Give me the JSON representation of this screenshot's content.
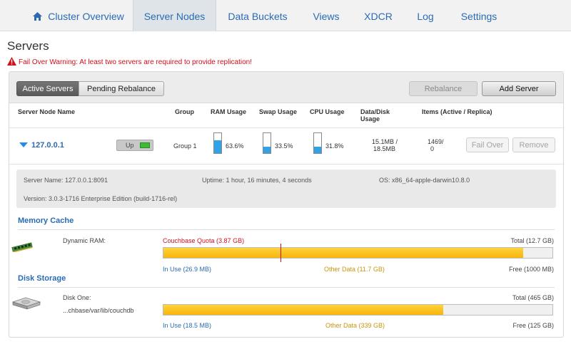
{
  "nav": {
    "tabs": [
      {
        "label": "Cluster Overview",
        "icon": "home-icon"
      },
      {
        "label": "Server Nodes",
        "active": true
      },
      {
        "label": "Data Buckets"
      },
      {
        "label": "Views"
      },
      {
        "label": "XDCR"
      },
      {
        "label": "Log"
      },
      {
        "label": "Settings"
      }
    ]
  },
  "page": {
    "title": "Servers",
    "warning": "Fail Over Warning: At least two servers are required to provide replication!"
  },
  "toolbar": {
    "active_tab": "Active Servers",
    "pending_tab": "Pending Rebalance",
    "rebalance": "Rebalance",
    "add_server": "Add Server"
  },
  "columns": {
    "name": "Server Node Name",
    "group": "Group",
    "ram": "RAM Usage",
    "swap": "Swap Usage",
    "cpu": "CPU Usage",
    "data_disk": "Data/Disk Usage",
    "items": "Items (Active / Replica)"
  },
  "node": {
    "name": "127.0.0.1",
    "status": "Up",
    "group": "Group 1",
    "ram_pct": 63.6,
    "ram_label": "63.6%",
    "swap_pct": 33.5,
    "swap_label": "33.5%",
    "cpu_pct": 31.8,
    "cpu_label": "31.8%",
    "data_line1": "15.1MB /",
    "data_line2": "18.5MB",
    "items_line1": "1469/",
    "items_line2": "0",
    "fail_over": "Fail Over",
    "remove": "Remove"
  },
  "details": {
    "server_name": "Server Name: 127.0.0.1:8091",
    "uptime": "Uptime: 1 hour, 16 minutes, 4 seconds",
    "os": "OS: x86_64-apple-darwin10.8.0",
    "version": "Version: 3.0.3-1716 Enterprise Edition (build-1716-rel)"
  },
  "memory": {
    "section_title": "Memory Cache",
    "label": "Dynamic RAM:",
    "quota": "Couchbase Quota (3.87 GB)",
    "total": "Total (12.7 GB)",
    "in_use": "In Use (26.9 MB)",
    "other": "Other Data (11.7 GB)",
    "free": "Free (1000 MB)",
    "used_fraction": 0.924,
    "quota_fraction": 0.3
  },
  "disk": {
    "section_title": "Disk Storage",
    "label": "Disk One:",
    "path": "...chbase/var/lib/couchdb",
    "total": "Total (465 GB)",
    "in_use": "In Use (18.5 MB)",
    "other": "Other Data (339 GB)",
    "free": "Free (125 GB)",
    "used_fraction": 0.72
  },
  "colors": {
    "link": "#2a6bb3",
    "warning": "#d0101d",
    "gauge": "#2fa3e6",
    "bar": "#f7b50c",
    "status_up": "#3dbb35"
  }
}
